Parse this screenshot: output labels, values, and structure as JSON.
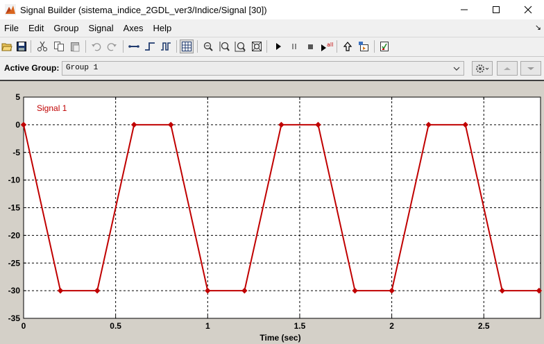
{
  "window": {
    "title": "Signal Builder (sistema_indice_2GDL_ver3/Indice/Signal [30])",
    "icon": "matlab-signal-builder-icon"
  },
  "menu": {
    "items": [
      "File",
      "Edit",
      "Group",
      "Signal",
      "Axes",
      "Help"
    ]
  },
  "toolbar": {
    "icons": [
      "open-icon",
      "save-icon",
      "cut-icon",
      "copy-icon",
      "paste-icon",
      "undo-icon",
      "redo-icon",
      "constant-segment-icon",
      "step-icon",
      "pulse-icon",
      "grid-icon",
      "zoom-x-icon",
      "zoom-y-icon",
      "zoom-xy-icon",
      "fit-view-icon",
      "play-icon",
      "pause-icon",
      "stop-icon",
      "run-all-icon",
      "move-up-icon",
      "show-block-icon",
      "verification-icon"
    ]
  },
  "group": {
    "label": "Active Group:",
    "selected": "Group 1"
  },
  "chart_data": {
    "type": "line",
    "series": [
      {
        "name": "Signal 1",
        "color": "#c00000",
        "x": [
          0,
          0.2,
          0.4,
          0.6,
          0.8,
          1.0,
          1.2,
          1.4,
          1.6,
          1.8,
          2.0,
          2.2,
          2.4,
          2.6,
          2.8
        ],
        "y": [
          0,
          -30,
          -30,
          0,
          0,
          -30,
          -30,
          0,
          0,
          -30,
          -30,
          0,
          0,
          -30,
          -30
        ]
      }
    ],
    "xlabel": "Time (sec)",
    "ylabel": "",
    "xlim": [
      0,
      2.8
    ],
    "ylim": [
      -35,
      5
    ],
    "xticks": [
      0,
      0.5,
      1,
      1.5,
      2,
      2.5
    ],
    "xtick_labels": [
      "0",
      "0.5",
      "1",
      "1.5",
      "2",
      "2.5"
    ],
    "yticks": [
      5,
      0,
      -5,
      -10,
      -15,
      -20,
      -25,
      -30,
      -35
    ],
    "ytick_labels": [
      "5",
      "0",
      "-5",
      "-10",
      "-15",
      "-20",
      "-25",
      "-30",
      "-35"
    ],
    "grid": true,
    "legend": "top-left"
  }
}
